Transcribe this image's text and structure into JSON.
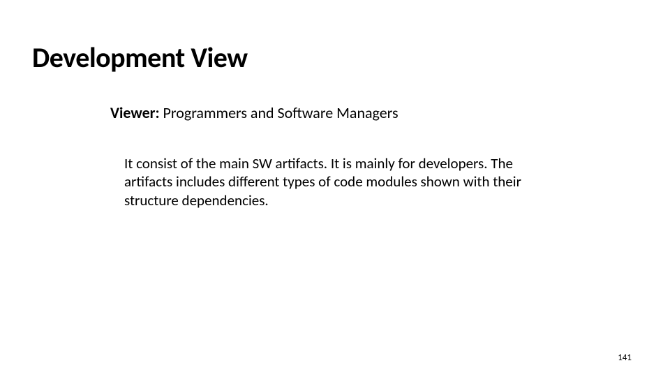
{
  "title": "Development View",
  "viewer": {
    "label": "Viewer:",
    "text": " Programmers and Software Managers"
  },
  "body": "It consist of the main SW artifacts. It is mainly for developers. The artifacts includes different types of code modules shown with their structure dependencies.",
  "page_number": "141"
}
